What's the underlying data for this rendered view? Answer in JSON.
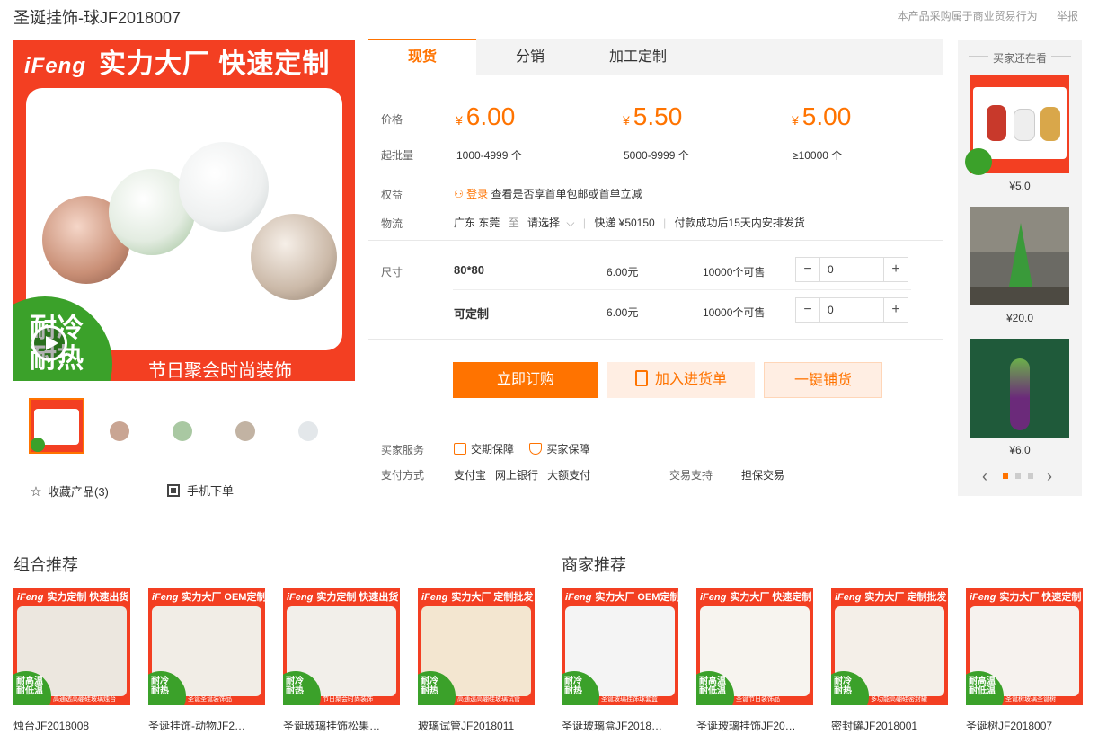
{
  "product": {
    "title": "圣诞挂饰-球JF2018007",
    "top_links": [
      "本产品采购属于商业贸易行为",
      "举报"
    ]
  },
  "main_image": {
    "logo": "iFeng",
    "banner_top": "实力大厂 快速定制",
    "badge_lines": [
      "耐冷",
      "耐热"
    ],
    "banner_bottom": "节日聚会时尚装饰"
  },
  "thumbnail_count": 5,
  "favorite_label": "收藏产品(3)",
  "mobile_label": "手机下单",
  "tabs": [
    "现货",
    "分销",
    "加工定制"
  ],
  "pricing": {
    "price_label": "价格",
    "moq_label": "起批量",
    "currency": "¥",
    "tiers": [
      {
        "price": "6.00",
        "range": "1000-4999 个"
      },
      {
        "price": "5.50",
        "range": "5000-9999 个"
      },
      {
        "price": "5.00",
        "range": "≥10000 个"
      }
    ]
  },
  "benefits": {
    "label": "权益",
    "login": "登录",
    "text": "查看是否享首单包邮或首单立减"
  },
  "logistics": {
    "label": "物流",
    "from": "广东 东莞",
    "to_word": "至",
    "select": "请选择",
    "express": "快递 ¥50150",
    "ship": "付款成功后15天内安排发货"
  },
  "sku": {
    "label": "尺寸",
    "rows": [
      {
        "name": "80*80",
        "price": "6.00元",
        "stock": "10000个可售",
        "qty": "0"
      },
      {
        "name": "可定制",
        "price": "6.00元",
        "stock": "10000个可售",
        "qty": "0"
      }
    ]
  },
  "buttons": {
    "buy": "立即订购",
    "cart": "加入进货单",
    "distribute": "一键铺货"
  },
  "service": {
    "label": "买家服务",
    "items": [
      "交期保障",
      "买家保障"
    ],
    "pay_label": "支付方式",
    "pay_methods": [
      "支付宝",
      "网上银行",
      "大额支付"
    ],
    "trade_label": "交易支持",
    "trade_value": "担保交易"
  },
  "sidebar": {
    "title": "买家还在看",
    "items": [
      {
        "price": "¥5.0"
      },
      {
        "price": "¥20.0"
      },
      {
        "price": "¥6.0"
      }
    ],
    "page_count": 3,
    "active_page": 1
  },
  "sections": {
    "combo_title": "组合推荐",
    "merchant_title": "商家推荐"
  },
  "recommend": [
    {
      "tag": "实力定制 快速出货",
      "name": "烛台JF2018008",
      "foot": "高通透高硼硅玻璃烛台",
      "badge": [
        "耐高温",
        "耐低温"
      ]
    },
    {
      "tag": "实力大厂 OEM定制",
      "name": "圣诞挂饰-动物JF2…",
      "foot": "圣诞圣诞装饰品",
      "badge": [
        "耐冷",
        "耐热"
      ]
    },
    {
      "tag": "实力定制 快速出货",
      "name": "圣诞玻璃挂饰松果…",
      "foot": "节日聚会时尚装饰",
      "badge": [
        "耐冷",
        "耐热"
      ]
    },
    {
      "tag": "实力大厂 定制批发",
      "name": "玻璃试管JF2018011",
      "foot": "高通透高硼硅玻璃试管",
      "badge": [
        "耐冷",
        "耐热"
      ]
    },
    {
      "tag": "实力大厂 OEM定制",
      "name": "圣诞玻璃盒JF2018…",
      "foot": "圣诞玻璃挂饰球套盒",
      "badge": [
        "耐冷",
        "耐热"
      ]
    },
    {
      "tag": "实力大厂 快速定制",
      "name": "圣诞玻璃挂饰JF20…",
      "foot": "圣诞节日装饰品",
      "badge": [
        "耐高温",
        "耐低温"
      ]
    },
    {
      "tag": "实力大厂 定制批发",
      "name": "密封罐JF2018001",
      "foot": "多功能高硼硅密封罐",
      "badge": [
        "耐冷",
        "耐热"
      ]
    },
    {
      "tag": "实力大厂 快速定制",
      "name": "圣诞树JF2018007",
      "foot": "圣诞树玻璃圣诞树",
      "badge": [
        "耐高温",
        "耐低温"
      ]
    }
  ],
  "colors": {
    "accent": "#ff7300",
    "banner_red": "#f33f22",
    "badge_green": "#3ba12a"
  }
}
